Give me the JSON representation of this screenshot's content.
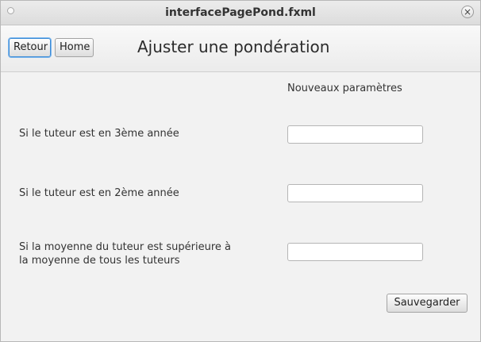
{
  "window": {
    "title": "interfacePagePond.fxml",
    "close_symbol": "×"
  },
  "header": {
    "back_label": "Retour",
    "home_label": "Home",
    "page_title": "Ajuster une pondération"
  },
  "form": {
    "column_header": "Nouveaux paramètres",
    "rows": [
      {
        "label": "Si le tuteur est en 3ème année",
        "value": ""
      },
      {
        "label": "Si le tuteur est en 2ème année",
        "value": ""
      },
      {
        "label_line1": "Si la moyenne du tuteur est supérieure à",
        "label_line2": "la moyenne de tous les tuteurs",
        "value": ""
      }
    ],
    "save_label": "Sauvegarder"
  }
}
